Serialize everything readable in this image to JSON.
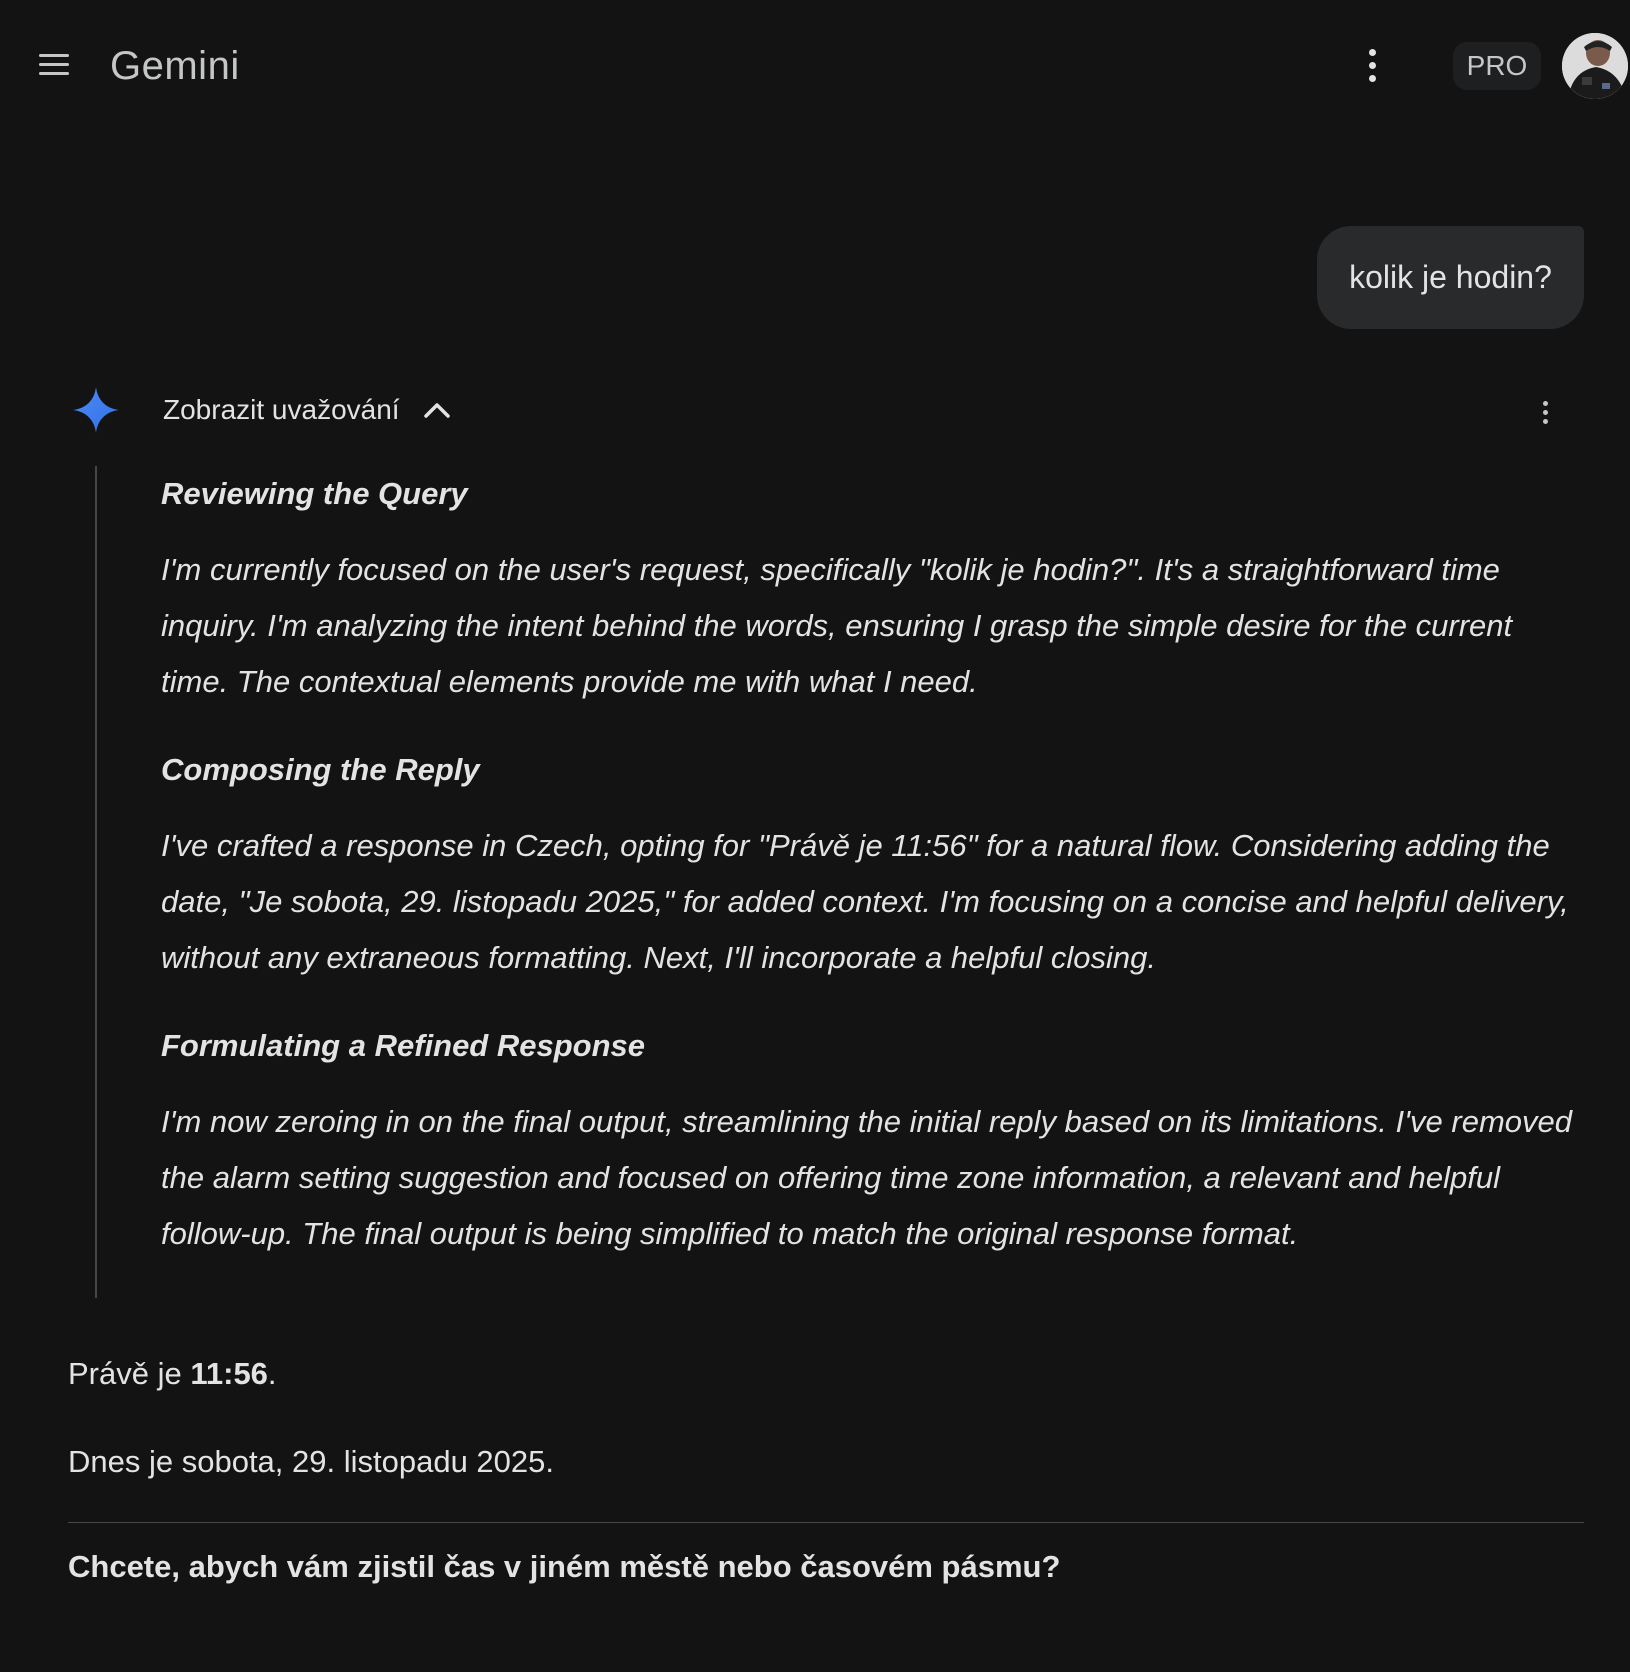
{
  "header": {
    "app_title": "Gemini",
    "plan_badge": "PRO",
    "menu_icon": "menu-icon",
    "more_icon": "more-vert-icon"
  },
  "conversation": {
    "user_message": "kolik je hodin?",
    "response": {
      "show_thinking_label": "Zobrazit uvažování",
      "thinking": [
        {
          "heading": "Reviewing the Query",
          "text": "I'm currently focused on the user's request, specifically \"kolik je hodin?\". It's a straightforward time inquiry. I'm analyzing the intent behind the words, ensuring I grasp the simple desire for the current time. The contextual elements provide me with what I need."
        },
        {
          "heading": "Composing the Reply",
          "text": "I've crafted a response in Czech, opting for \"Právě je 11:56\" for a natural flow. Considering adding the date, \"Je sobota, 29. listopadu 2025,\" for added context. I'm focusing on a concise and helpful delivery, without any extraneous formatting. Next, I'll incorporate a helpful closing."
        },
        {
          "heading": "Formulating a Refined Response",
          "text": "I'm now zeroing in on the final output, streamlining the initial reply based on its limitations. I've removed the alarm setting suggestion and focused on offering time zone information, a relevant and helpful follow-up. The final output is being simplified to match the original response format."
        }
      ],
      "answer_prefix": "Právě je ",
      "answer_time": "11:56",
      "answer_suffix": ".",
      "answer_date": "Dnes je sobota, 29. listopadu 2025.",
      "followup_question": "Chcete, abych vám zjistil čas v jiném městě nebo časovém pásmu?"
    }
  },
  "colors": {
    "background": "#131313",
    "text": "#e3e3e3",
    "bubble": "#282a2c",
    "gemini_blue": "#4285f4"
  }
}
